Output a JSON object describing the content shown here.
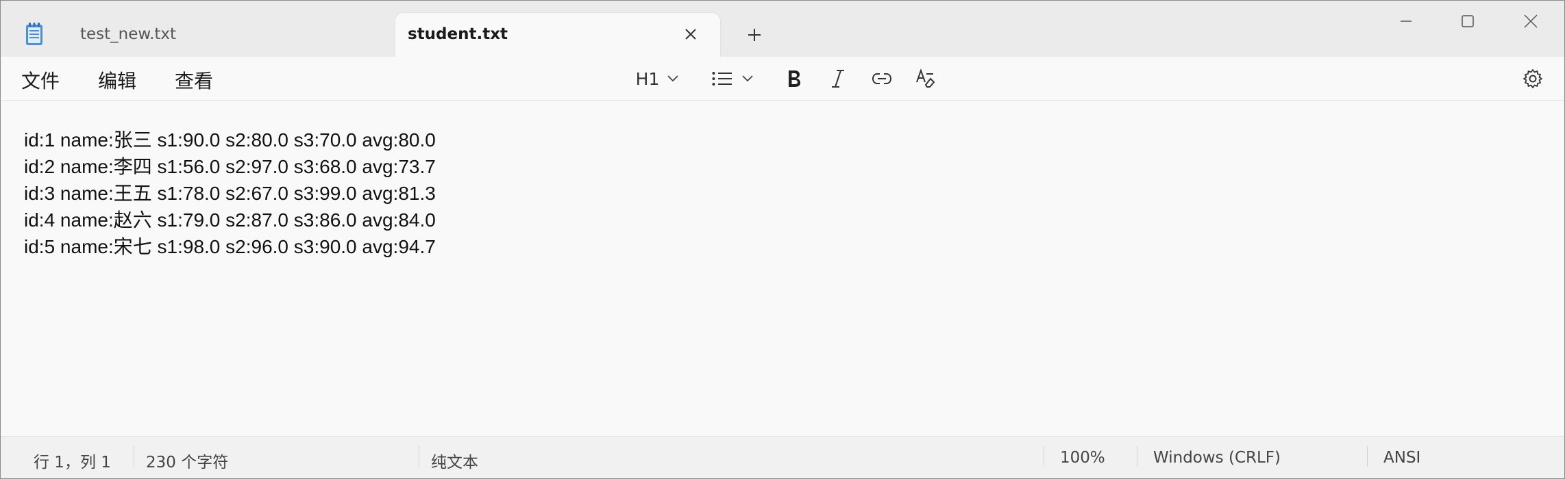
{
  "tabs": [
    {
      "label": "test_new.txt",
      "active": false
    },
    {
      "label": "student.txt",
      "active": true
    }
  ],
  "menu": {
    "file": "文件",
    "edit": "编辑",
    "view": "查看"
  },
  "toolbar": {
    "heading_label": "H1"
  },
  "editor": {
    "lines": [
      "id:1 name:张三 s1:90.0 s2:80.0 s3:70.0 avg:80.0",
      "id:2 name:李四 s1:56.0 s2:97.0 s3:68.0 avg:73.7",
      "id:3 name:王五 s1:78.0 s2:67.0 s3:99.0 avg:81.3",
      "id:4 name:赵六 s1:79.0 s2:87.0 s3:86.0 avg:84.0",
      "id:5 name:宋七 s1:98.0 s2:96.0 s3:90.0 avg:94.7"
    ]
  },
  "status": {
    "position": "行 1，列 1",
    "char_count": "230 个字符",
    "format": "纯文本",
    "zoom": "100%",
    "line_ending": "Windows (CRLF)",
    "encoding": "ANSI"
  },
  "icons": {
    "app": "notepad-icon",
    "close_tab": "close-icon",
    "new_tab": "plus-icon",
    "heading_dropdown": "chevron-down-icon",
    "list": "bulleted-list-icon",
    "bold": "bold-icon",
    "italic": "italic-icon",
    "link": "link-icon",
    "clear_format": "clear-formatting-icon",
    "settings": "gear-icon"
  },
  "colors": {
    "accent": "#1a73e8",
    "tab_active_bg": "#f9f9f9",
    "titlebar_bg": "#ebebeb"
  }
}
